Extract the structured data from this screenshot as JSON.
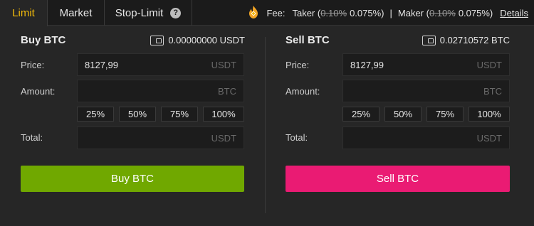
{
  "tabs": {
    "limit": "Limit",
    "market": "Market",
    "stop_limit": "Stop-Limit",
    "help": "?"
  },
  "fee": {
    "label": "Fee:",
    "taker_label": "Taker (",
    "taker_old": "0.10%",
    "taker_new": "0.075%)",
    "separator": "|",
    "maker_label": "Maker (",
    "maker_old": "0.10%",
    "maker_new": "0.075%)",
    "details": "Details"
  },
  "buy": {
    "title": "Buy BTC",
    "balance": "0.00000000 USDT",
    "price_label": "Price:",
    "price_value": "8127,99",
    "price_unit": "USDT",
    "amount_label": "Amount:",
    "amount_value": "",
    "amount_unit": "BTC",
    "percents": [
      "25%",
      "50%",
      "75%",
      "100%"
    ],
    "total_label": "Total:",
    "total_value": "",
    "total_unit": "USDT",
    "button": "Buy BTC"
  },
  "sell": {
    "title": "Sell BTC",
    "balance": "0.02710572 BTC",
    "price_label": "Price:",
    "price_value": "8127,99",
    "price_unit": "USDT",
    "amount_label": "Amount:",
    "amount_value": "",
    "amount_unit": "BTC",
    "percents": [
      "25%",
      "50%",
      "75%",
      "100%"
    ],
    "total_label": "Total:",
    "total_value": "",
    "total_unit": "USDT",
    "button": "Sell BTC"
  },
  "colors": {
    "accent": "#f0b90b",
    "buy": "#70a800",
    "sell": "#ea1b73"
  }
}
